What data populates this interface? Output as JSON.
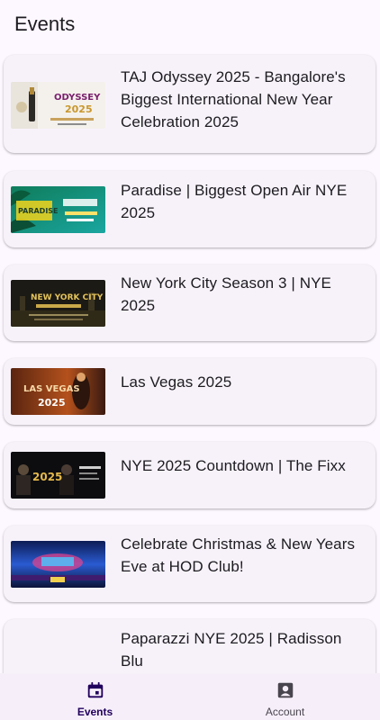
{
  "app_bar": {
    "title": "Events"
  },
  "events": [
    {
      "title": "TAJ Odyssey 2025 - Bangalore's Biggest International New Year Celebration 2025",
      "thumb_icon": "odyssey-poster",
      "thumb_text": "ODYSSEY 2025"
    },
    {
      "title": "Paradise | Biggest Open Air NYE 2025",
      "thumb_icon": "paradise-poster",
      "thumb_text": "PARADISE"
    },
    {
      "title": "New York City Season 3 | NYE 2025",
      "thumb_icon": "nyc-poster",
      "thumb_text": "NEW YORK CITY"
    },
    {
      "title": "Las Vegas 2025",
      "thumb_icon": "las-vegas-poster",
      "thumb_text": "LAS VEGAS 2025"
    },
    {
      "title": "NYE 2025 Countdown | The Fixx",
      "thumb_icon": "fixx-poster",
      "thumb_text": "2025"
    },
    {
      "title": "Celebrate Christmas & New Years Eve at HOD Club!",
      "thumb_icon": "hod-poster",
      "thumb_text": ""
    },
    {
      "title": "Paparazzi NYE 2025 | Radisson Blu",
      "thumb_icon": "",
      "thumb_text": ""
    }
  ],
  "nav": {
    "events_label": "Events",
    "account_label": "Account",
    "active": "events"
  },
  "colors": {
    "background": "#fdf7ff",
    "card": "#f7f2fa",
    "nav_active": "#21005d",
    "nav_inactive": "#49454f"
  }
}
